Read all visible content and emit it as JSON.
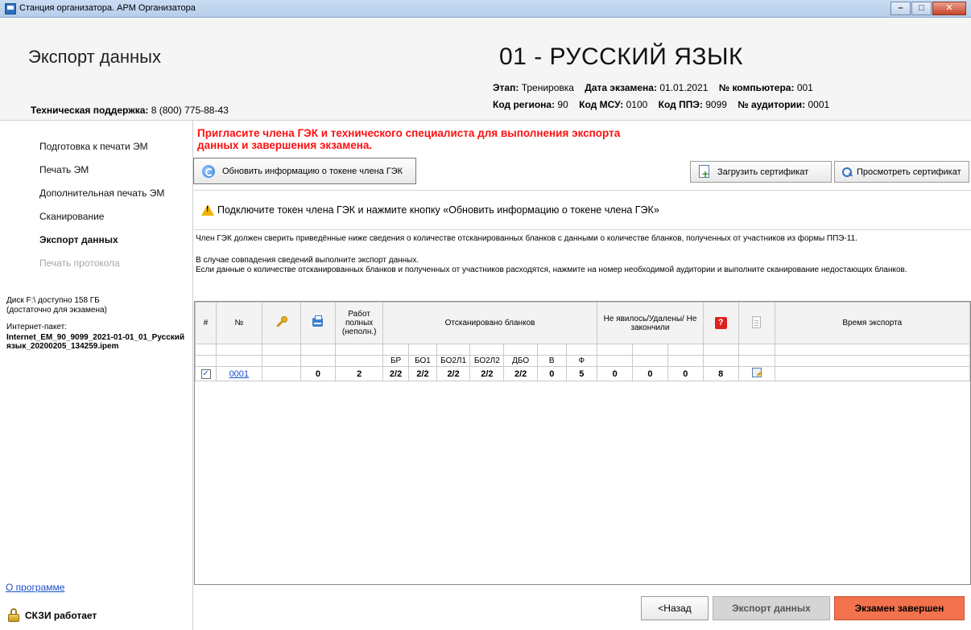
{
  "window": {
    "title": "Станция организатора. АРМ Организатора",
    "minimize": "–",
    "maximize": "□",
    "close": "✕"
  },
  "header": {
    "page_title": "Экспорт данных",
    "support_label": "Техническая поддержка:",
    "support_phone": "8 (800) 775-88-43",
    "subject": "01 - РУССКИЙ ЯЗЫК",
    "stage_label": "Этап:",
    "stage": "Тренировка",
    "date_label": "Дата экзамена:",
    "date": "01.01.2021",
    "computer_label": "№ компьютера:",
    "computer": "001",
    "region_label": "Код региона:",
    "region": "90",
    "msu_label": "Код МСУ:",
    "msu": "0100",
    "ppe_label": "Код ППЭ:",
    "ppe": "9099",
    "room_label": "№ аудитории:",
    "room": "0001"
  },
  "sidebar": {
    "items": [
      {
        "label": "Подготовка к печати ЭМ",
        "state": "normal"
      },
      {
        "label": "Печать ЭМ",
        "state": "normal"
      },
      {
        "label": "Дополнительная печать ЭМ",
        "state": "normal"
      },
      {
        "label": "Сканирование",
        "state": "normal"
      },
      {
        "label": "Экспорт данных",
        "state": "active"
      },
      {
        "label": "Печать протокола",
        "state": "disabled"
      }
    ],
    "disk_line1": "Диск F:\\ доступно 158 ГБ",
    "disk_line2": "(достаточно для экзамена)",
    "internet_label": "Интернет-пакет:",
    "internet_file": "Internet_EM_90_9099_2021-01-01_01_Русский язык_20200205_134259.ipem",
    "about": "О программе",
    "skzi": "СКЗИ работает"
  },
  "main": {
    "warning_red": "Пригласите члена ГЭК и технического специалиста для выполнения экспорта данных и завершения экзамена.",
    "refresh_button": "Обновить информацию о токене члена ГЭК",
    "upload_cert_button": "Загрузить сертификат",
    "view_cert_button": "Просмотреть сертификат",
    "token_warning": "Подключите токен члена ГЭК и нажмите кнопку «Обновить информацию о токене члена ГЭК»",
    "desc1": "Член ГЭК должен сверить приведённые ниже сведения о количестве отсканированных бланков с данными о количестве бланков, полученных от участников из формы ППЭ-11.",
    "desc2": "В случае совпадения сведений выполните экспорт данных.",
    "desc3": "Если данные о количестве отсканированных бланков и полученных от участников расходятся, нажмите на номер необходимой аудитории и выполните сканирование недостающих бланков."
  },
  "table": {
    "col_hash": "#",
    "col_no": "№",
    "col_works": "Работ полных (неполн.)",
    "col_scanned": "Отсканировано бланков",
    "col_absent": "Не явилось/Удалены/ Не закончили",
    "col_time": "Время экспорта",
    "sub_headers": [
      "БР",
      "БО1",
      "БО2Л1",
      "БО2Л2",
      "ДБО",
      "В",
      "Ф"
    ],
    "row": {
      "checkbox": "✓",
      "no": "0001",
      "printed": "0",
      "works": "2",
      "br": "2/2",
      "bo1": "2/2",
      "bo2l1": "2/2",
      "bo2l2": "2/2",
      "dbo": "2/2",
      "v": "0",
      "f": "5",
      "absent1": "0",
      "absent2": "0",
      "absent3": "0",
      "q": "8",
      "time": ""
    }
  },
  "footer": {
    "back": "<Назад",
    "export": "Экспорт данных",
    "finish": "Экзамен завершен"
  }
}
